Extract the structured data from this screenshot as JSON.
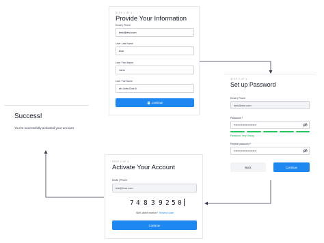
{
  "colors": {
    "accent": "#1e88f0",
    "strength": "#22c55e",
    "link": "#1e88f0"
  },
  "success": {
    "title": "Success!",
    "message": "You've successfully activated your account"
  },
  "provide_info": {
    "step": "STEP 1 OF 3",
    "title": "Provide Your Information",
    "email_label": "Email | Phone",
    "email_value": "test@test.com",
    "last_name_label": "User Last Name",
    "last_name_value": "Doe",
    "first_name_label": "User First Name",
    "first_name_value": "John",
    "full_name_label": "User Full Name",
    "full_name_value": "ah John Doe ll",
    "continue_label": "Continue",
    "continue_icon": "lock-icon"
  },
  "setup_password": {
    "step": "STEP 2 OF 3",
    "title": "Set up Password",
    "email_label": "Email | Phone",
    "email_value": "test@test.com",
    "password_label": "Password *",
    "password_value": "••••••••••••••••••••••••",
    "strength_text": "Password: Very Strong",
    "repeat_label": "Repeat password *",
    "repeat_value": "••••••••••••••••••••••••",
    "eye_icon": "eye-off-icon",
    "back_label": "Back",
    "continue_label": "Continue"
  },
  "activate": {
    "step": "STEP 3 OF 3",
    "title": "Activate Your Account",
    "email_label": "Email | Phone",
    "email_value": "test@test.com",
    "otp_digits": [
      "7",
      "4",
      "8",
      "3",
      "9",
      "2",
      "5",
      "0"
    ],
    "sms_prompt": "SMS didn't receive?",
    "resend_label": "Resend code",
    "continue_label": "Continue"
  }
}
